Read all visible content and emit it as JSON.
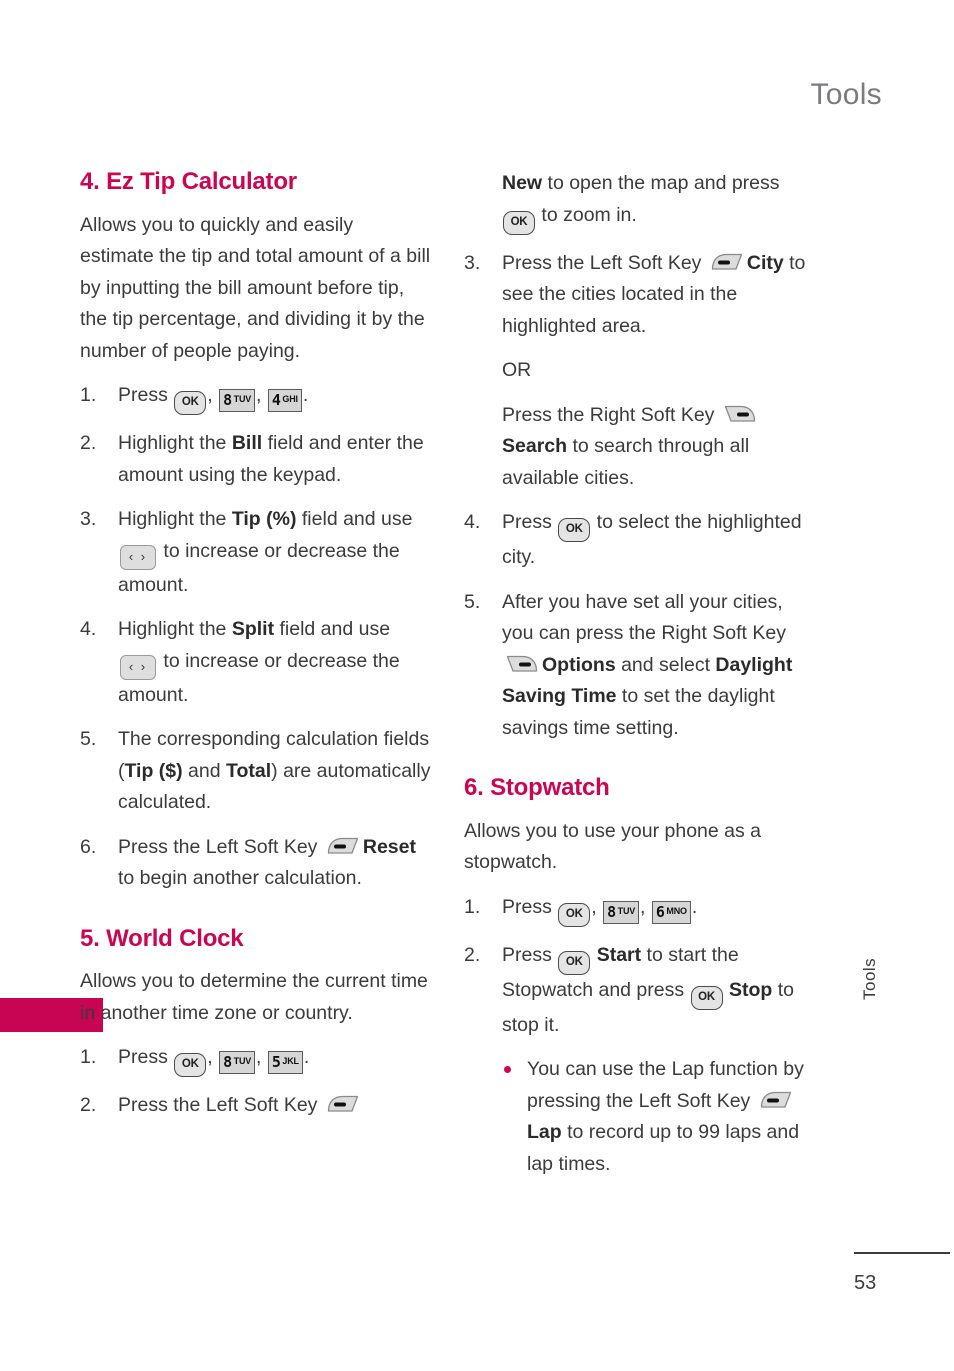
{
  "page": {
    "header_title": "Tools",
    "number": "53",
    "side_tab_label": "Tools",
    "accent_color": "#cc0452",
    "side_tab_block_color": "#c80552",
    "header_color": "#7b7b7f"
  },
  "icons": {
    "ok_key": "OK",
    "nav_left_right": "‹ ›",
    "key_8": {
      "digit": "8",
      "letters": "TUV"
    },
    "key_4": {
      "digit": "4",
      "letters": "GHI"
    },
    "key_5": {
      "digit": "5",
      "letters": "JKL"
    },
    "key_6": {
      "digit": "6",
      "letters": "MNO"
    }
  },
  "left_column": {
    "sections": [
      {
        "title": "4. Ez Tip Calculator",
        "intro": "Allows you to quickly and easily estimate the tip and total amount of a bill by inputting the bill amount before tip, the tip percentage, and dividing it by the number of people paying.",
        "steps": [
          {
            "num": "1.",
            "pre": "Press ",
            "mid": ", ",
            "mid2": ", ",
            "post": "."
          },
          {
            "num": "2.",
            "text_a": "Highlight the ",
            "bold_a": "Bill",
            "text_b": " field and enter the amount using the keypad."
          },
          {
            "num": "3.",
            "text_a": "Highlight the ",
            "bold_a": "Tip (%)",
            "text_b": " field and use ",
            "text_c": " to increase or decrease the amount."
          },
          {
            "num": "4.",
            "text_a": "Highlight the ",
            "bold_a": "Split",
            "text_b": " field and use ",
            "text_c": " to increase or decrease the amount."
          },
          {
            "num": "5.",
            "text_a": "The corresponding calculation fields (",
            "bold_a": "Tip ($)",
            "text_b": " and ",
            "bold_b": "Total",
            "text_c": ") are automatically calculated."
          },
          {
            "num": "6.",
            "text_a": "Press the Left Soft Key ",
            "bold_a": "Reset",
            "text_b": " to begin another calculation."
          }
        ]
      },
      {
        "title": "5. World Clock",
        "intro": "Allows you to determine the current time in another time zone or country.",
        "steps": [
          {
            "num": "1.",
            "pre": "Press ",
            "mid": ", ",
            "mid2": ", ",
            "post": "."
          },
          {
            "num": "2.",
            "text_a": "Press the Left Soft Key "
          }
        ]
      }
    ]
  },
  "right_column": {
    "continued": {
      "bold_a": "New",
      "text_a": " to open the map and press ",
      "text_b": " to zoom in."
    },
    "steps_world_clock": [
      {
        "num": "3.",
        "text_a": "Press the Left Soft Key ",
        "bold_a": "City",
        "text_b": " to see the cities located in the highlighted area.",
        "or_label": "OR",
        "alt_text_a": "Press the Right Soft Key ",
        "alt_bold_a": "Search",
        "alt_text_b": " to search through all available cities."
      },
      {
        "num": "4.",
        "text_a": "Press ",
        "text_b": " to select the highlighted city."
      },
      {
        "num": "5.",
        "text_a": "After you have set all your cities, you can press the Right Soft Key ",
        "bold_a": "Options",
        "text_b": " and select ",
        "bold_b": "Daylight Saving Time",
        "text_c": " to set the daylight savings time setting."
      }
    ],
    "sections": [
      {
        "title": "6. Stopwatch",
        "intro": "Allows you to use your phone as a stopwatch.",
        "steps": [
          {
            "num": "1.",
            "pre": "Press ",
            "mid": ", ",
            "mid2": ", ",
            "post": "."
          },
          {
            "num": "2.",
            "text_a": "Press ",
            "bold_a": "Start",
            "text_b": " to start the Stopwatch and press ",
            "bold_b": "Stop",
            "text_c": " to stop it."
          }
        ],
        "bullets": [
          {
            "text_a": "You can use the Lap function by pressing the Left Soft Key ",
            "bold_a": "Lap",
            "text_b": " to record up to 99 laps and lap times."
          }
        ]
      }
    ]
  }
}
